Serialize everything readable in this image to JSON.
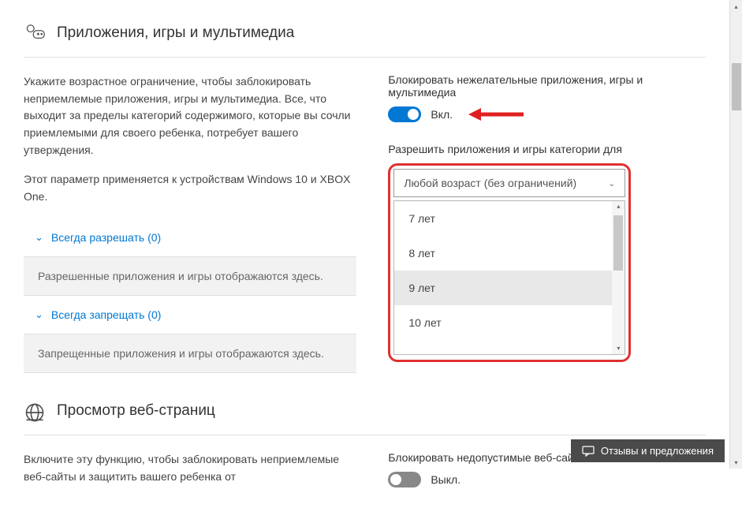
{
  "section_apps": {
    "title": "Приложения, игры и мультимедиа",
    "description1": "Укажите возрастное ограничение, чтобы заблокировать неприемлемые приложения, игры и мультимедиа. Все, что выходит за пределы категорий содержимого, которые вы сочли приемлемыми для своего ребенка, потребует вашего утверждения.",
    "description2": "Этот параметр применяется к устройствам Windows 10 и XBOX One.",
    "block_label": "Блокировать нежелательные приложения, игры и мультимедиа",
    "toggle_state": "Вкл.",
    "allow_label": "Разрешить приложения и игры категории для",
    "dropdown_selected": "Любой возраст (без ограничений)",
    "dropdown_options": [
      "7 лет",
      "8 лет",
      "9 лет",
      "10 лет"
    ],
    "always_allow": "Всегда разрешать (0)",
    "allowed_empty": "Разрешенные приложения и игры отображаются здесь.",
    "always_block": "Всегда запрещать (0)",
    "blocked_empty": "Запрещенные приложения и игры отображаются здесь."
  },
  "section_web": {
    "title": "Просмотр веб-страниц",
    "description": "Включите эту функцию, чтобы заблокировать неприемлемые веб-сайты и защитить вашего ребенка от",
    "block_label": "Блокировать недопустимые веб-сайты",
    "toggle_state": "Выкл."
  },
  "feedback": "Отзывы и предложения"
}
